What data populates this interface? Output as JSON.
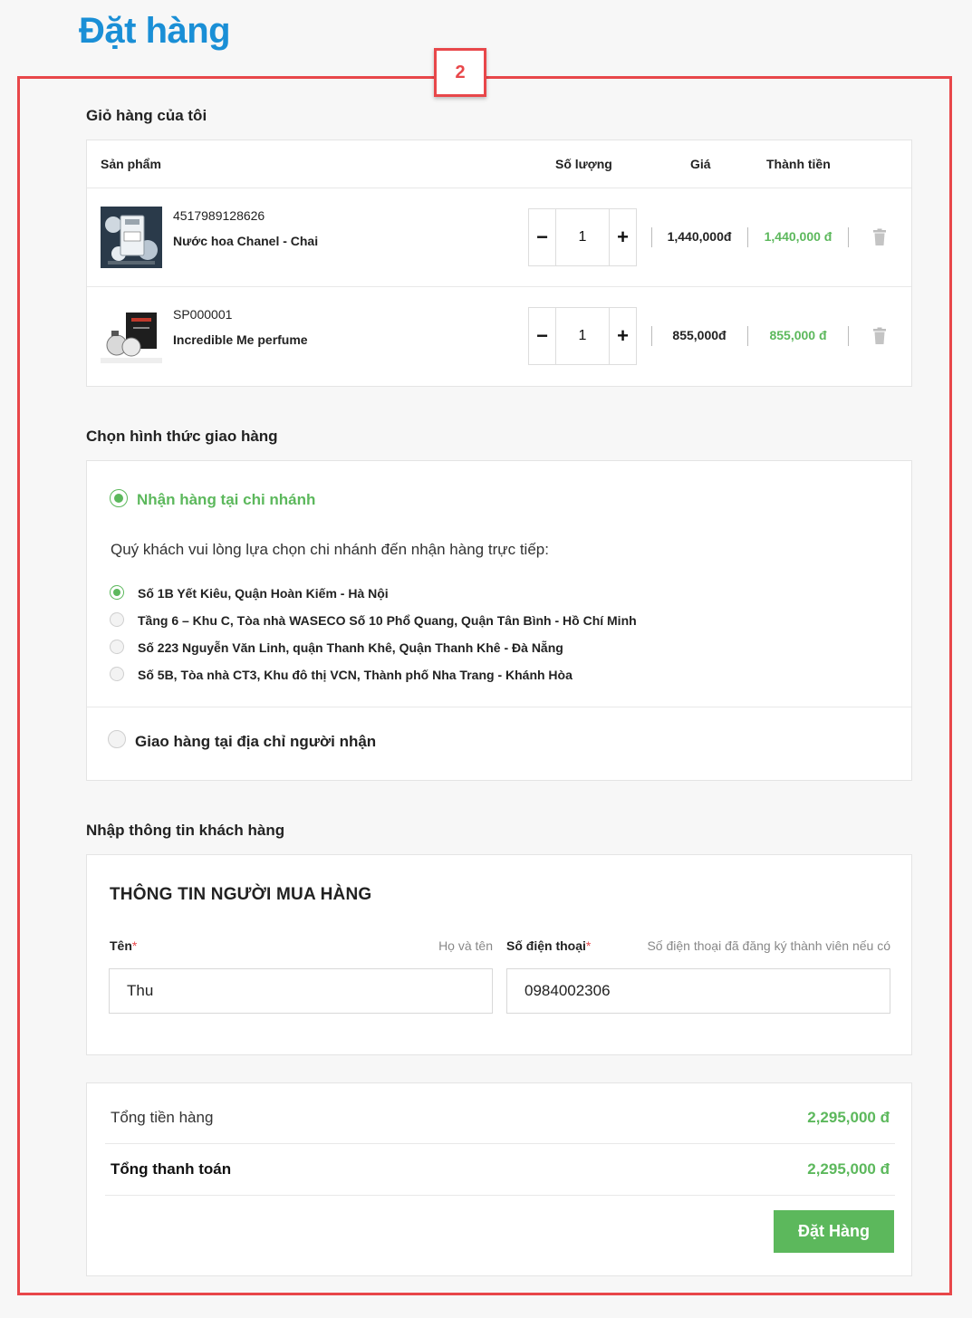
{
  "page_title": "Đặt hàng",
  "marker_label": "2",
  "cart": {
    "heading": "Giỏ hàng của tôi",
    "columns": {
      "product": "Sản phẩm",
      "quantity": "Số lượng",
      "price": "Giá",
      "subtotal": "Thành tiền"
    },
    "items": [
      {
        "sku": "4517989128626",
        "name": "Nước hoa Chanel - Chai",
        "qty": "1",
        "price": "1,440,000đ",
        "subtotal": "1,440,000 đ",
        "minus": "−",
        "plus": "+"
      },
      {
        "sku": "SP000001",
        "name": "Incredible Me perfume",
        "qty": "1",
        "price": "855,000đ",
        "subtotal": "855,000 đ",
        "minus": "−",
        "plus": "+"
      }
    ]
  },
  "shipping": {
    "heading": "Chọn hình thức giao hàng",
    "pickup_label": "Nhận hàng tại chi nhánh",
    "pickup_hint": "Quý khách vui lòng lựa chọn chi nhánh đến nhận hàng trực tiếp:",
    "branches": [
      {
        "label": "Số 1B Yết Kiêu, Quận Hoàn Kiếm - Hà Nội",
        "selected": true
      },
      {
        "label": "Tầng 6 – Khu C, Tòa nhà WASECO Số 10 Phổ Quang, Quận Tân Bình - Hồ Chí Minh",
        "selected": false
      },
      {
        "label": "Số 223 Nguyễn Văn Linh, quận Thanh Khê, Quận Thanh Khê - Đà Nẵng",
        "selected": false
      },
      {
        "label": "Số 5B, Tòa nhà CT3, Khu đô thị VCN, Thành phố Nha Trang - Khánh Hòa",
        "selected": false
      }
    ],
    "delivery_label": "Giao hàng tại địa chỉ người nhận"
  },
  "customer": {
    "heading": "Nhập thông tin khách hàng",
    "form_title": "THÔNG TIN NGƯỜI MUA HÀNG",
    "name_label": "Tên",
    "name_hint": "Họ và tên",
    "name_value": "Thu",
    "phone_label": "Số điện thoại",
    "phone_hint": "Số điện thoại đã đăng ký thành viên nếu có",
    "phone_value": "0984002306",
    "required_mark": "*"
  },
  "totals": {
    "goods_label": "Tổng tiền hàng",
    "goods_value": "2,295,000 đ",
    "pay_label": "Tổng thanh toán",
    "pay_value": "2,295,000 đ",
    "order_button": "Đặt Hàng"
  },
  "colors": {
    "accent_blue": "#1a8fd6",
    "green": "#5cb85c",
    "annotation_red": "#e8474a"
  }
}
